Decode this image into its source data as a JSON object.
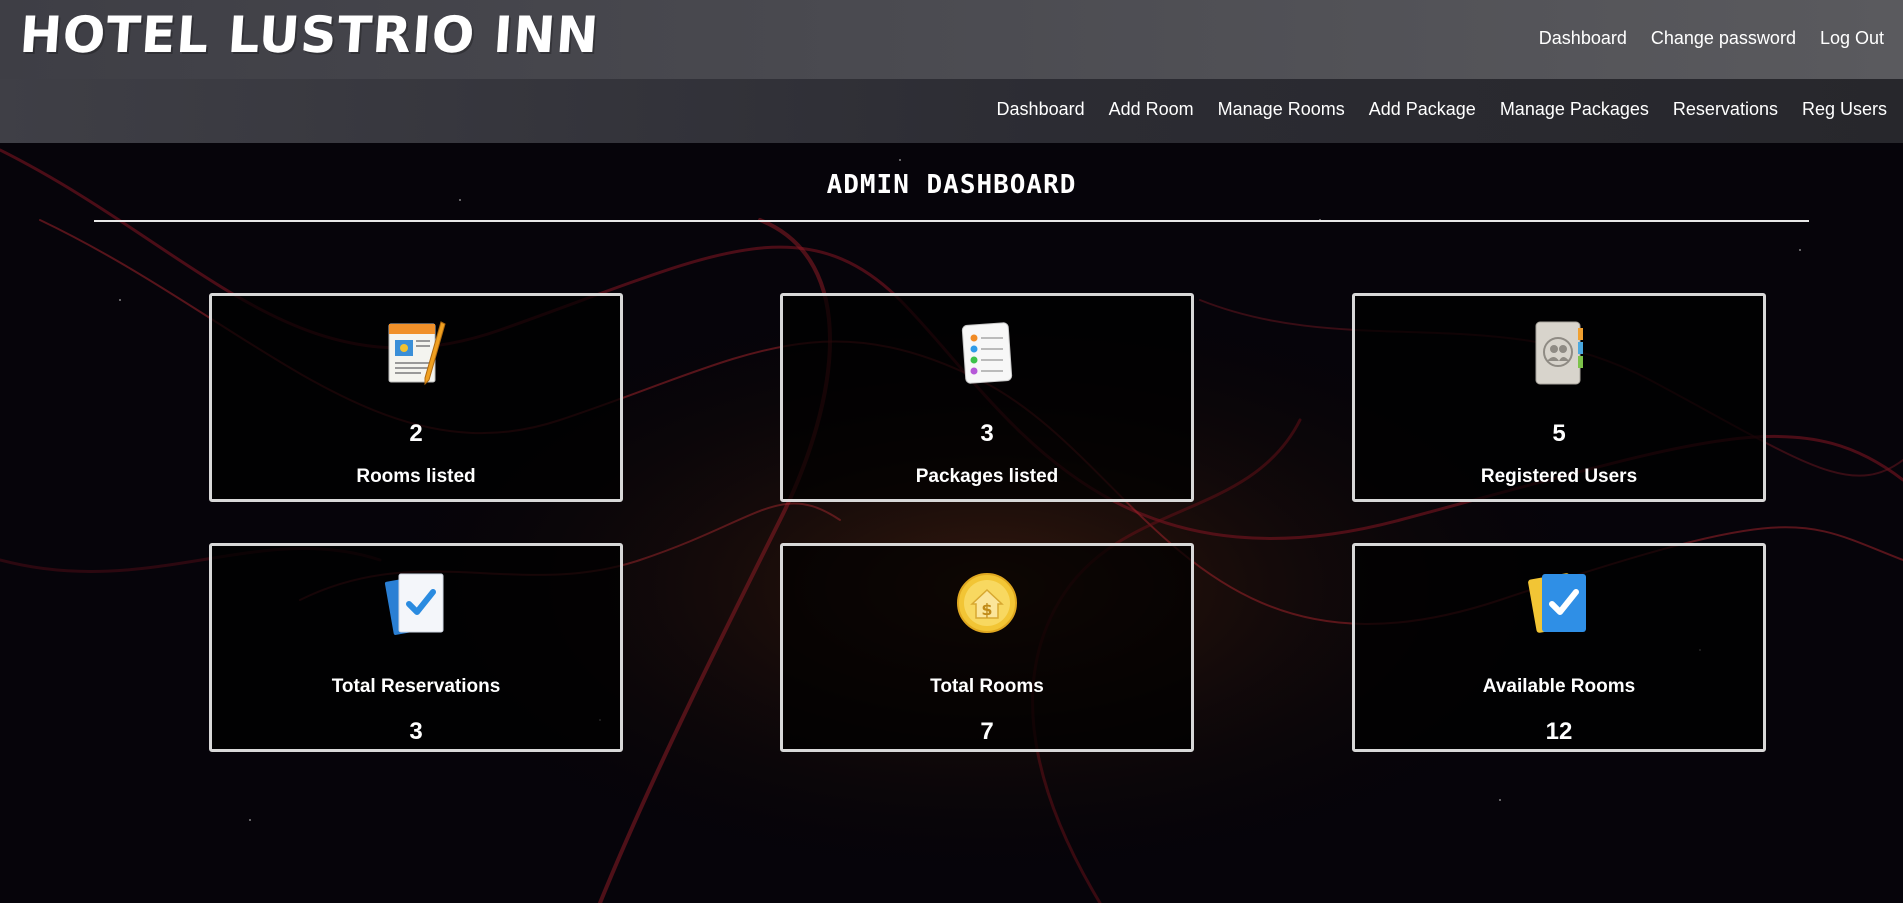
{
  "brand": {
    "title": "HOTEL LUSTRIO INN"
  },
  "top_nav": [
    {
      "label": "Dashboard"
    },
    {
      "label": "Change password"
    },
    {
      "label": "Log Out"
    }
  ],
  "sub_nav": [
    {
      "label": "Dashboard"
    },
    {
      "label": "Add Room"
    },
    {
      "label": "Manage Rooms"
    },
    {
      "label": "Add Package"
    },
    {
      "label": "Manage Packages"
    },
    {
      "label": "Reservations"
    },
    {
      "label": "Reg Users"
    }
  ],
  "page": {
    "heading": "ADMIN DASHBOARD"
  },
  "stats": [
    {
      "value": "2",
      "label": "Rooms listed",
      "icon": "pages-document-icon"
    },
    {
      "value": "3",
      "label": "Packages listed",
      "icon": "reminders-list-icon"
    },
    {
      "value": "5",
      "label": "Registered Users",
      "icon": "contacts-book-icon"
    },
    {
      "value": "3",
      "label": "Total Reservations",
      "icon": "checked-document-icon"
    },
    {
      "value": "7",
      "label": "Total Rooms",
      "icon": "house-dollar-coin-icon"
    },
    {
      "value": "12",
      "label": "Available Rooms",
      "icon": "blue-check-notes-icon"
    }
  ],
  "colors": {
    "topbar": "#4a4a50",
    "subbar": "#2c2c33",
    "background": "#050308",
    "card_border": "#d8d8d8"
  }
}
